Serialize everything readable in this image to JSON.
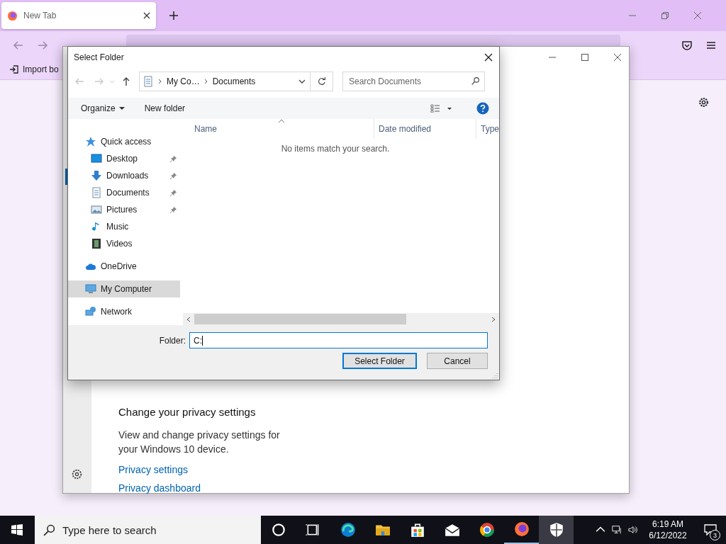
{
  "browser": {
    "tab": {
      "title": "New Tab",
      "selected": true
    },
    "bookmarks": [
      {
        "label": "Import bo"
      }
    ]
  },
  "settings_window": {
    "heading": "Change your privacy settings",
    "description": "View and change privacy settings for your Windows 10 device.",
    "links": [
      "Privacy settings",
      "Privacy dashboard"
    ]
  },
  "dialog": {
    "title": "Select Folder",
    "breadcrumb": [
      "My Co…",
      "Documents"
    ],
    "search": {
      "placeholder": "Search Documents"
    },
    "commands": [
      "Organize",
      "New folder"
    ],
    "nav": [
      {
        "label": "Quick access",
        "selected": false,
        "children": [
          {
            "label": "Desktop",
            "pinned": true,
            "selected": false
          },
          {
            "label": "Downloads",
            "pinned": true,
            "selected": false
          },
          {
            "label": "Documents",
            "pinned": true,
            "selected": false
          },
          {
            "label": "Pictures",
            "pinned": true,
            "selected": false
          },
          {
            "label": "Music",
            "pinned": false,
            "selected": false
          },
          {
            "label": "Videos",
            "pinned": false,
            "selected": false
          }
        ]
      },
      {
        "label": "OneDrive",
        "selected": false
      },
      {
        "label": "My Computer",
        "selected": true
      },
      {
        "label": "Network",
        "selected": false
      }
    ],
    "columns": [
      "Name",
      "Date modified",
      "Type"
    ],
    "empty_message": "No items match your search.",
    "folder": {
      "label": "Folder:",
      "value": "C:"
    },
    "buttons": [
      {
        "label": "Select Folder",
        "default": true
      },
      {
        "label": "Cancel",
        "default": false
      }
    ]
  },
  "taskbar": {
    "search": {
      "placeholder": "Type here to search"
    },
    "apps": [
      {
        "running": false,
        "selected": false
      },
      {
        "running": false,
        "selected": false
      },
      {
        "running": false,
        "selected": false
      },
      {
        "running": false,
        "selected": false
      },
      {
        "running": false,
        "selected": false
      },
      {
        "running": false,
        "selected": false
      },
      {
        "running": false,
        "selected": false
      },
      {
        "running": true,
        "selected": false
      },
      {
        "running": false,
        "selected": true
      }
    ],
    "time": "6:19 AM",
    "date": "6/12/2022",
    "notifications": "3"
  }
}
